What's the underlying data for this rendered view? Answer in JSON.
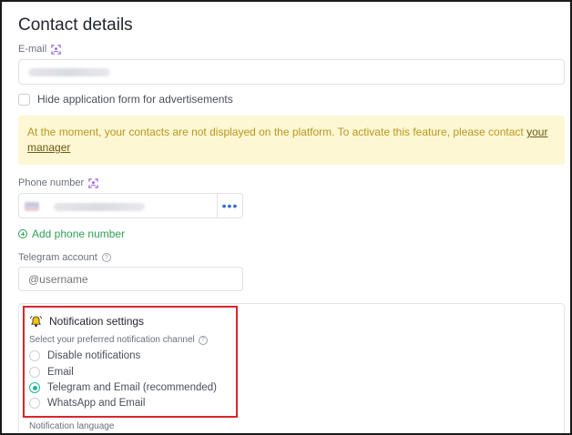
{
  "page": {
    "title": "Contact details"
  },
  "email": {
    "label": "E-mail"
  },
  "hide_form": {
    "label": "Hide application form for advertisements",
    "checked": false
  },
  "notice": {
    "text": "At the moment, your contacts are not displayed on the platform. To activate this feature, please contact ",
    "link": "your manager"
  },
  "phone": {
    "label": "Phone number",
    "more_label": "•••",
    "add_label": "Add phone number"
  },
  "telegram": {
    "label": "Telegram account",
    "placeholder": "@username"
  },
  "notifications": {
    "title": "Notification settings",
    "channel_label": "Select your preferred notification channel",
    "options": [
      {
        "label": "Disable notifications",
        "selected": false
      },
      {
        "label": "Email",
        "selected": false
      },
      {
        "label": "Telegram and Email (recommended)",
        "selected": true
      },
      {
        "label": "WhatsApp and Email",
        "selected": false
      }
    ],
    "language_label": "Notification language"
  },
  "colors": {
    "accent_green": "#2f9f55",
    "radio_selected": "#1fb89a",
    "notice_bg": "#fdf7d4",
    "highlight_border": "#d9262b"
  }
}
